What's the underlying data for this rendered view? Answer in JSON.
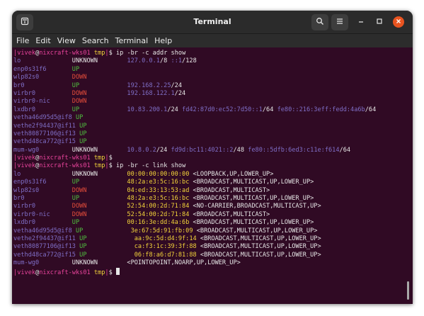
{
  "window": {
    "title": "Terminal",
    "menu": [
      "File",
      "Edit",
      "View",
      "Search",
      "Terminal",
      "Help"
    ],
    "icons": {
      "new_tab": "new-tab-icon",
      "search": "search-icon",
      "hamburger": "hamburger-menu-icon",
      "minimize": "minimize-icon",
      "maximize": "maximize-icon",
      "close": "close-icon"
    },
    "colors": {
      "terminal_bg": "#300a24",
      "user_host": "#e9449c",
      "dir": "#f2d33a",
      "up": "#4fbf3f",
      "down": "#e24c3a",
      "ip": "#7f6ec7",
      "text": "#e6e6e6"
    }
  },
  "terminal": {
    "lines": [
      [
        {
          "t": "|",
          "c": "user_host"
        },
        {
          "t": "vivek",
          "c": "user_host"
        },
        {
          "t": "@",
          "c": "text"
        },
        {
          "t": "nixcraft-wks01",
          "c": "user_host"
        },
        {
          "t": " ",
          "c": "text"
        },
        {
          "t": "tmp",
          "c": "dir"
        },
        {
          "t": "|",
          "c": "user_host"
        },
        {
          "t": "$ ip -br -c addr show",
          "c": "text"
        }
      ],
      [
        {
          "t": "lo              ",
          "c": "ip"
        },
        {
          "t": "UNKNOWN        ",
          "c": "text"
        },
        {
          "t": "127.0.0.1",
          "c": "ip"
        },
        {
          "t": "/8 ",
          "c": "text"
        },
        {
          "t": "::1",
          "c": "ip"
        },
        {
          "t": "/128",
          "c": "text"
        }
      ],
      [
        {
          "t": "enp0s31f6       ",
          "c": "ip"
        },
        {
          "t": "UP",
          "c": "up"
        }
      ],
      [
        {
          "t": "wlp82s0         ",
          "c": "ip"
        },
        {
          "t": "DOWN",
          "c": "down"
        }
      ],
      [
        {
          "t": "br0             ",
          "c": "ip"
        },
        {
          "t": "UP             ",
          "c": "up"
        },
        {
          "t": "192.168.2.25",
          "c": "ip"
        },
        {
          "t": "/24",
          "c": "text"
        }
      ],
      [
        {
          "t": "virbr0          ",
          "c": "ip"
        },
        {
          "t": "DOWN           ",
          "c": "down"
        },
        {
          "t": "192.168.122.1",
          "c": "ip"
        },
        {
          "t": "/24",
          "c": "text"
        }
      ],
      [
        {
          "t": "virbr0-nic      ",
          "c": "ip"
        },
        {
          "t": "DOWN",
          "c": "down"
        }
      ],
      [
        {
          "t": "lxdbr0          ",
          "c": "ip"
        },
        {
          "t": "UP             ",
          "c": "up"
        },
        {
          "t": "10.83.200.1",
          "c": "ip"
        },
        {
          "t": "/24 ",
          "c": "text"
        },
        {
          "t": "fd42:87d0:ec52:7d50::1",
          "c": "ip"
        },
        {
          "t": "/64 ",
          "c": "text"
        },
        {
          "t": "fe80::216:3eff:fedd:4a6b",
          "c": "ip"
        },
        {
          "t": "/64",
          "c": "text"
        }
      ],
      [
        {
          "t": "vetha46d95d5@if8 ",
          "c": "ip"
        },
        {
          "t": "UP",
          "c": "up"
        }
      ],
      [
        {
          "t": "vethe2f94437@if11 ",
          "c": "ip"
        },
        {
          "t": "UP",
          "c": "up"
        }
      ],
      [
        {
          "t": "veth80877106@if13 ",
          "c": "ip"
        },
        {
          "t": "UP",
          "c": "up"
        }
      ],
      [
        {
          "t": "vethd48ca772@if15 ",
          "c": "ip"
        },
        {
          "t": "UP",
          "c": "up"
        }
      ],
      [
        {
          "t": "mum-wg0         ",
          "c": "ip"
        },
        {
          "t": "UNKNOWN        ",
          "c": "text"
        },
        {
          "t": "10.8.0.2",
          "c": "ip"
        },
        {
          "t": "/24 ",
          "c": "text"
        },
        {
          "t": "fd9d:bc11:4021::2",
          "c": "ip"
        },
        {
          "t": "/48 ",
          "c": "text"
        },
        {
          "t": "fe80::5dfb:6ed3:c11e:f614",
          "c": "ip"
        },
        {
          "t": "/64",
          "c": "text"
        }
      ],
      [
        {
          "t": "|",
          "c": "user_host"
        },
        {
          "t": "vivek",
          "c": "user_host"
        },
        {
          "t": "@",
          "c": "text"
        },
        {
          "t": "nixcraft-wks01",
          "c": "user_host"
        },
        {
          "t": " ",
          "c": "text"
        },
        {
          "t": "tmp",
          "c": "dir"
        },
        {
          "t": "|",
          "c": "user_host"
        },
        {
          "t": "$",
          "c": "text"
        }
      ],
      [
        {
          "t": "|",
          "c": "user_host"
        },
        {
          "t": "vivek",
          "c": "user_host"
        },
        {
          "t": "@",
          "c": "text"
        },
        {
          "t": "nixcraft-wks01",
          "c": "user_host"
        },
        {
          "t": " ",
          "c": "text"
        },
        {
          "t": "tmp",
          "c": "dir"
        },
        {
          "t": "|",
          "c": "user_host"
        },
        {
          "t": "$ ip -br -c link show",
          "c": "text"
        }
      ],
      [
        {
          "t": "lo              ",
          "c": "ip"
        },
        {
          "t": "UNKNOWN        ",
          "c": "text"
        },
        {
          "t": "00:00:00:00:00:00",
          "c": "dir"
        },
        {
          "t": " <LOOPBACK,UP,LOWER_UP>",
          "c": "text"
        }
      ],
      [
        {
          "t": "enp0s31f6       ",
          "c": "ip"
        },
        {
          "t": "UP             ",
          "c": "up"
        },
        {
          "t": "48:2a:e3:5c:16:bc",
          "c": "dir"
        },
        {
          "t": " <BROADCAST,MULTICAST,UP,LOWER_UP>",
          "c": "text"
        }
      ],
      [
        {
          "t": "wlp82s0         ",
          "c": "ip"
        },
        {
          "t": "DOWN           ",
          "c": "down"
        },
        {
          "t": "04:ed:33:13:53:ad",
          "c": "dir"
        },
        {
          "t": " <BROADCAST,MULTICAST>",
          "c": "text"
        }
      ],
      [
        {
          "t": "br0             ",
          "c": "ip"
        },
        {
          "t": "UP             ",
          "c": "up"
        },
        {
          "t": "48:2a:e3:5c:16:bc",
          "c": "dir"
        },
        {
          "t": " <BROADCAST,MULTICAST,UP,LOWER_UP>",
          "c": "text"
        }
      ],
      [
        {
          "t": "virbr0          ",
          "c": "ip"
        },
        {
          "t": "DOWN           ",
          "c": "down"
        },
        {
          "t": "52:54:00:2d:71:84",
          "c": "dir"
        },
        {
          "t": " <NO-CARRIER,BROADCAST,MULTICAST,UP>",
          "c": "text"
        }
      ],
      [
        {
          "t": "virbr0-nic      ",
          "c": "ip"
        },
        {
          "t": "DOWN           ",
          "c": "down"
        },
        {
          "t": "52:54:00:2d:71:84",
          "c": "dir"
        },
        {
          "t": " <BROADCAST,MULTICAST>",
          "c": "text"
        }
      ],
      [
        {
          "t": "lxdbr0          ",
          "c": "ip"
        },
        {
          "t": "UP             ",
          "c": "up"
        },
        {
          "t": "00:16:3e:dd:4a:6b",
          "c": "dir"
        },
        {
          "t": " <BROADCAST,MULTICAST,UP,LOWER_UP>",
          "c": "text"
        }
      ],
      [
        {
          "t": "vetha46d95d5@if8 ",
          "c": "ip"
        },
        {
          "t": "UP             ",
          "c": "up"
        },
        {
          "t": "3e:67:5d:91:fb:09",
          "c": "dir"
        },
        {
          "t": " <BROADCAST,MULTICAST,UP,LOWER_UP>",
          "c": "text"
        }
      ],
      [
        {
          "t": "vethe2f94437@if11 ",
          "c": "ip"
        },
        {
          "t": "UP             ",
          "c": "up"
        },
        {
          "t": "aa:9c:5d:d4:9f:14",
          "c": "dir"
        },
        {
          "t": " <BROADCAST,MULTICAST,UP,LOWER_UP>",
          "c": "text"
        }
      ],
      [
        {
          "t": "veth80877106@if13 ",
          "c": "ip"
        },
        {
          "t": "UP             ",
          "c": "up"
        },
        {
          "t": "ca:f3:1c:39:3f:88",
          "c": "dir"
        },
        {
          "t": " <BROADCAST,MULTICAST,UP,LOWER_UP>",
          "c": "text"
        }
      ],
      [
        {
          "t": "vethd48ca772@if15 ",
          "c": "ip"
        },
        {
          "t": "UP             ",
          "c": "up"
        },
        {
          "t": "06:f8:a6:d7:81:88",
          "c": "dir"
        },
        {
          "t": " <BROADCAST,MULTICAST,UP,LOWER_UP>",
          "c": "text"
        }
      ],
      [
        {
          "t": "mum-wg0         ",
          "c": "ip"
        },
        {
          "t": "UNKNOWN        ",
          "c": "text"
        },
        {
          "t": "<POINTOPOINT,NOARP,UP,LOWER_UP>",
          "c": "text"
        }
      ],
      [
        {
          "t": "|",
          "c": "user_host"
        },
        {
          "t": "vivek",
          "c": "user_host"
        },
        {
          "t": "@",
          "c": "text"
        },
        {
          "t": "nixcraft-wks01",
          "c": "user_host"
        },
        {
          "t": " ",
          "c": "text"
        },
        {
          "t": "tmp",
          "c": "dir"
        },
        {
          "t": "|",
          "c": "user_host"
        },
        {
          "t": "$ ",
          "c": "text"
        },
        {
          "t": "",
          "c": "cursor"
        }
      ]
    ]
  }
}
